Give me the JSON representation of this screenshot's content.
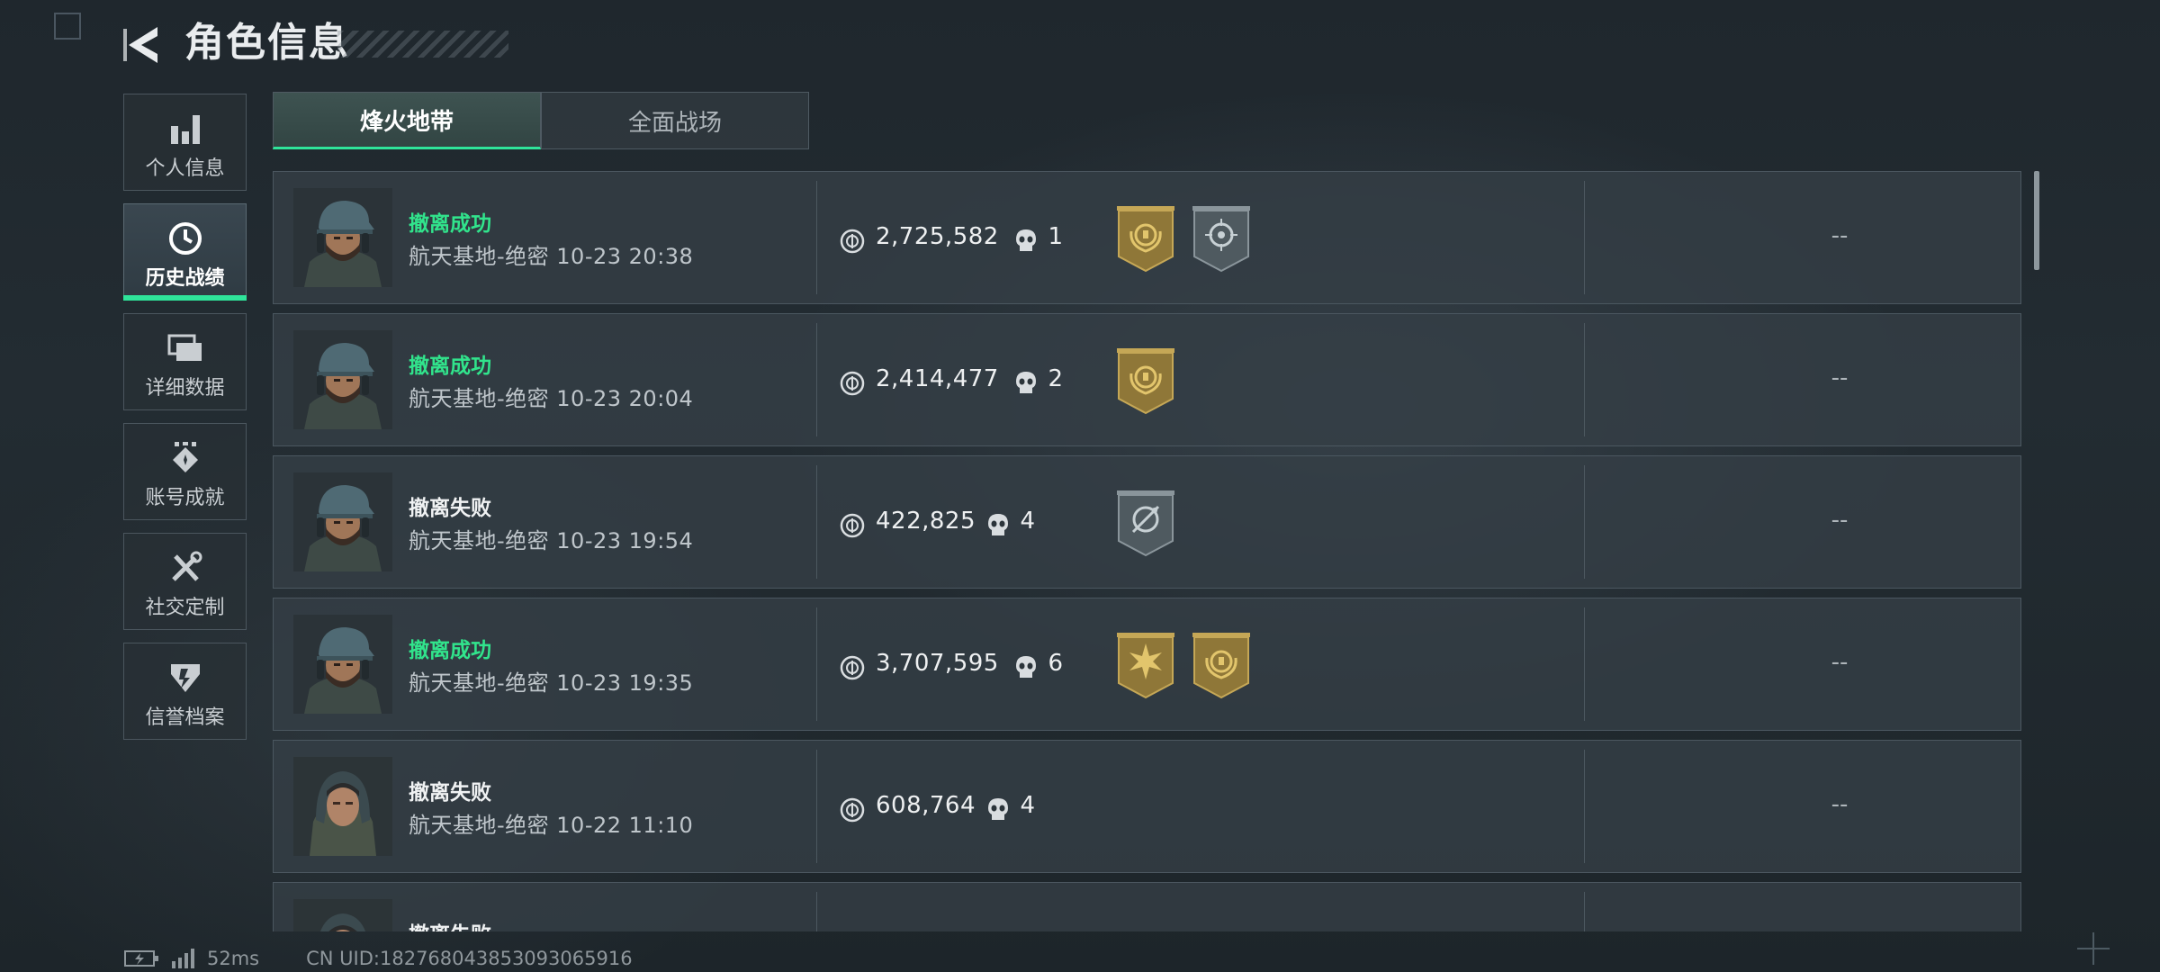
{
  "header": {
    "title": "角色信息"
  },
  "sidebar": {
    "items": [
      {
        "label": "个人信息",
        "icon": "bar-chart-icon",
        "active": false
      },
      {
        "label": "历史战绩",
        "icon": "clock-icon",
        "active": true
      },
      {
        "label": "详细数据",
        "icon": "folders-icon",
        "active": false
      },
      {
        "label": "账号成就",
        "icon": "achievement-icon",
        "active": false
      },
      {
        "label": "社交定制",
        "icon": "tools-icon",
        "active": false
      },
      {
        "label": "信誉档案",
        "icon": "shield-badge-icon",
        "active": false
      }
    ]
  },
  "tabs": [
    {
      "label": "烽火地带",
      "active": true
    },
    {
      "label": "全面战场",
      "active": false
    }
  ],
  "records": [
    {
      "status": "撤离成功",
      "success": true,
      "detail": "航天基地-绝密 10-23 20:38",
      "value": "2,725,582",
      "kills": "1",
      "badges": [
        "gold-laurel",
        "silver-crosshair"
      ],
      "rating": "--",
      "operator": "male-cap"
    },
    {
      "status": "撤离成功",
      "success": true,
      "detail": "航天基地-绝密 10-23 20:04",
      "value": "2,414,477",
      "kills": "2",
      "badges": [
        "gold-laurel"
      ],
      "rating": "--",
      "operator": "male-cap"
    },
    {
      "status": "撤离失败",
      "success": false,
      "detail": "航天基地-绝密 10-23 19:54",
      "value": "422,825",
      "kills": "4",
      "badges": [
        "silver-target"
      ],
      "rating": "--",
      "operator": "male-cap"
    },
    {
      "status": "撤离成功",
      "success": true,
      "detail": "航天基地-绝密 10-23 19:35",
      "value": "3,707,595",
      "kills": "6",
      "badges": [
        "gold-star",
        "gold-laurel"
      ],
      "rating": "--",
      "operator": "male-cap"
    },
    {
      "status": "撤离失败",
      "success": false,
      "detail": "航天基地-绝密 10-22 11:10",
      "value": "608,764",
      "kills": "4",
      "badges": [],
      "rating": "--",
      "operator": "female-hood"
    },
    {
      "status": "撤离失败",
      "success": false,
      "detail": "",
      "value": "",
      "kills": "",
      "badges": [],
      "rating": "",
      "operator": "female-hood"
    }
  ],
  "footer": {
    "ping": "52ms",
    "uid": "CN UID:182768043853093065916"
  },
  "colors": {
    "success": "#31e48c",
    "accent": "#2fe49a",
    "gold": "#b59a4a",
    "silver": "#6f7a80"
  }
}
